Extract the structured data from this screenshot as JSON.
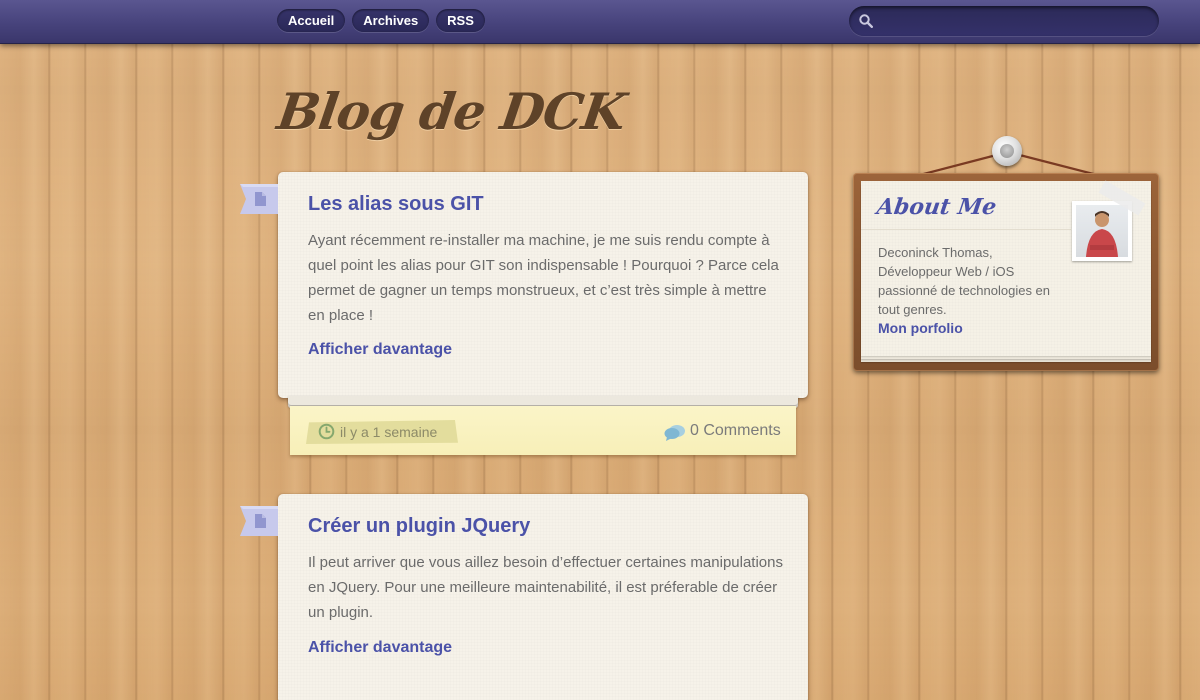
{
  "nav": {
    "items": [
      {
        "label": "Accueil"
      },
      {
        "label": "Archives"
      },
      {
        "label": "RSS"
      }
    ]
  },
  "search": {
    "placeholder": "",
    "value": "",
    "icon": "search-icon"
  },
  "blog": {
    "title": "Blog de DCK"
  },
  "posts": [
    {
      "title": "Les alias sous GIT",
      "excerpt": "Ayant récemment re-installer ma machine, je me suis rendu compte à quel point les alias pour GIT son indispensable ! Pourquoi ? Parce cela permet de gagner un temps monstrueux, et c’est très simple à mettre en place !",
      "read_more": "Afficher davantage",
      "date": "il y a 1 semaine",
      "comments": "0 Comments"
    },
    {
      "title": "Créer un plugin JQuery",
      "excerpt": "Il peut arriver que vous aillez besoin d’effectuer certaines manipulations en JQuery. Pour une meilleure maintenabilité, il est préferable de créer un plugin.",
      "read_more": "Afficher davantage"
    }
  ],
  "about": {
    "title": "About Me",
    "line1": "Deconinck Thomas,",
    "line2": "Développeur Web / iOS",
    "line3": "passionné de technologies en tout genres.",
    "link": "Mon porfolio"
  },
  "colors": {
    "accent": "#4b52a8",
    "topbar": "#47437c",
    "wood": "#dcae7c",
    "note": "#fbf5c8"
  }
}
